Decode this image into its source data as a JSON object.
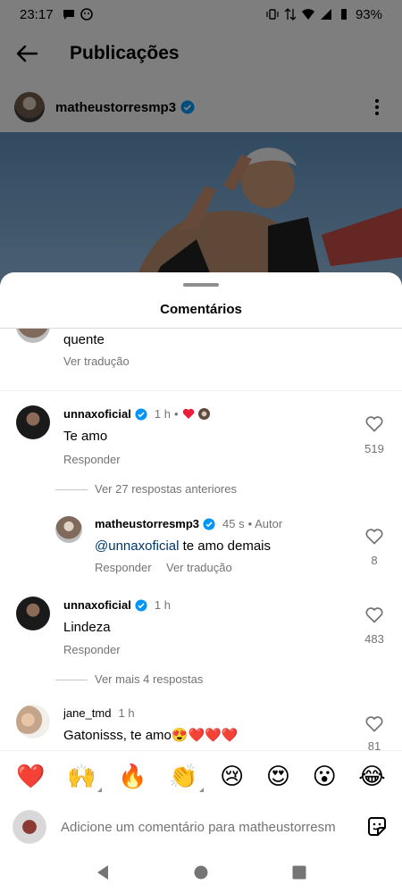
{
  "status_bar": {
    "time": "23:17",
    "battery": "93%"
  },
  "app_bar": {
    "title": "Publicações"
  },
  "post": {
    "username": "matheustorresmp3"
  },
  "sheet": {
    "title": "Comentários"
  },
  "comments": {
    "top_fragment": {
      "text": "quente",
      "translate": "Ver tradução"
    },
    "c1": {
      "username": "unnaxoficial",
      "time": "1 h",
      "bullet": "•",
      "text": "Te amo",
      "reply": "Responder",
      "likes": "519",
      "thread": "Ver 27 respostas anteriores"
    },
    "reply1": {
      "username": "matheustorresmp3",
      "time": "45 s",
      "author_tag": "• Autor",
      "mention": "@unnaxoficial",
      "text": " te amo demais",
      "reply": "Responder",
      "translate": "Ver tradução",
      "likes": "8"
    },
    "c2": {
      "username": "unnaxoficial",
      "time": "1 h",
      "text": "Lindeza",
      "reply": "Responder",
      "likes": "483",
      "thread": "Ver mais 4 respostas"
    },
    "c3": {
      "username": "jane_tmd",
      "time": "1 h",
      "text": "Gatonisss, te amo😍❤️❤️❤️",
      "likes": "81"
    }
  },
  "emoji_bar": [
    "❤️",
    "🙌",
    "🔥",
    "👏",
    "😢",
    "😍",
    "😮",
    "😂"
  ],
  "composer": {
    "placeholder": "Adicione um comentário para matheustorresm"
  },
  "icons": {
    "back": "arrow-left-icon",
    "verified": "verified-badge-icon",
    "more": "kebab-icon",
    "like": "heart-outline-icon",
    "sticker": "sticker-icon"
  },
  "colors": {
    "verified_blue": "#0095f6",
    "mention": "#00376b",
    "secondary_text": "#737373"
  }
}
